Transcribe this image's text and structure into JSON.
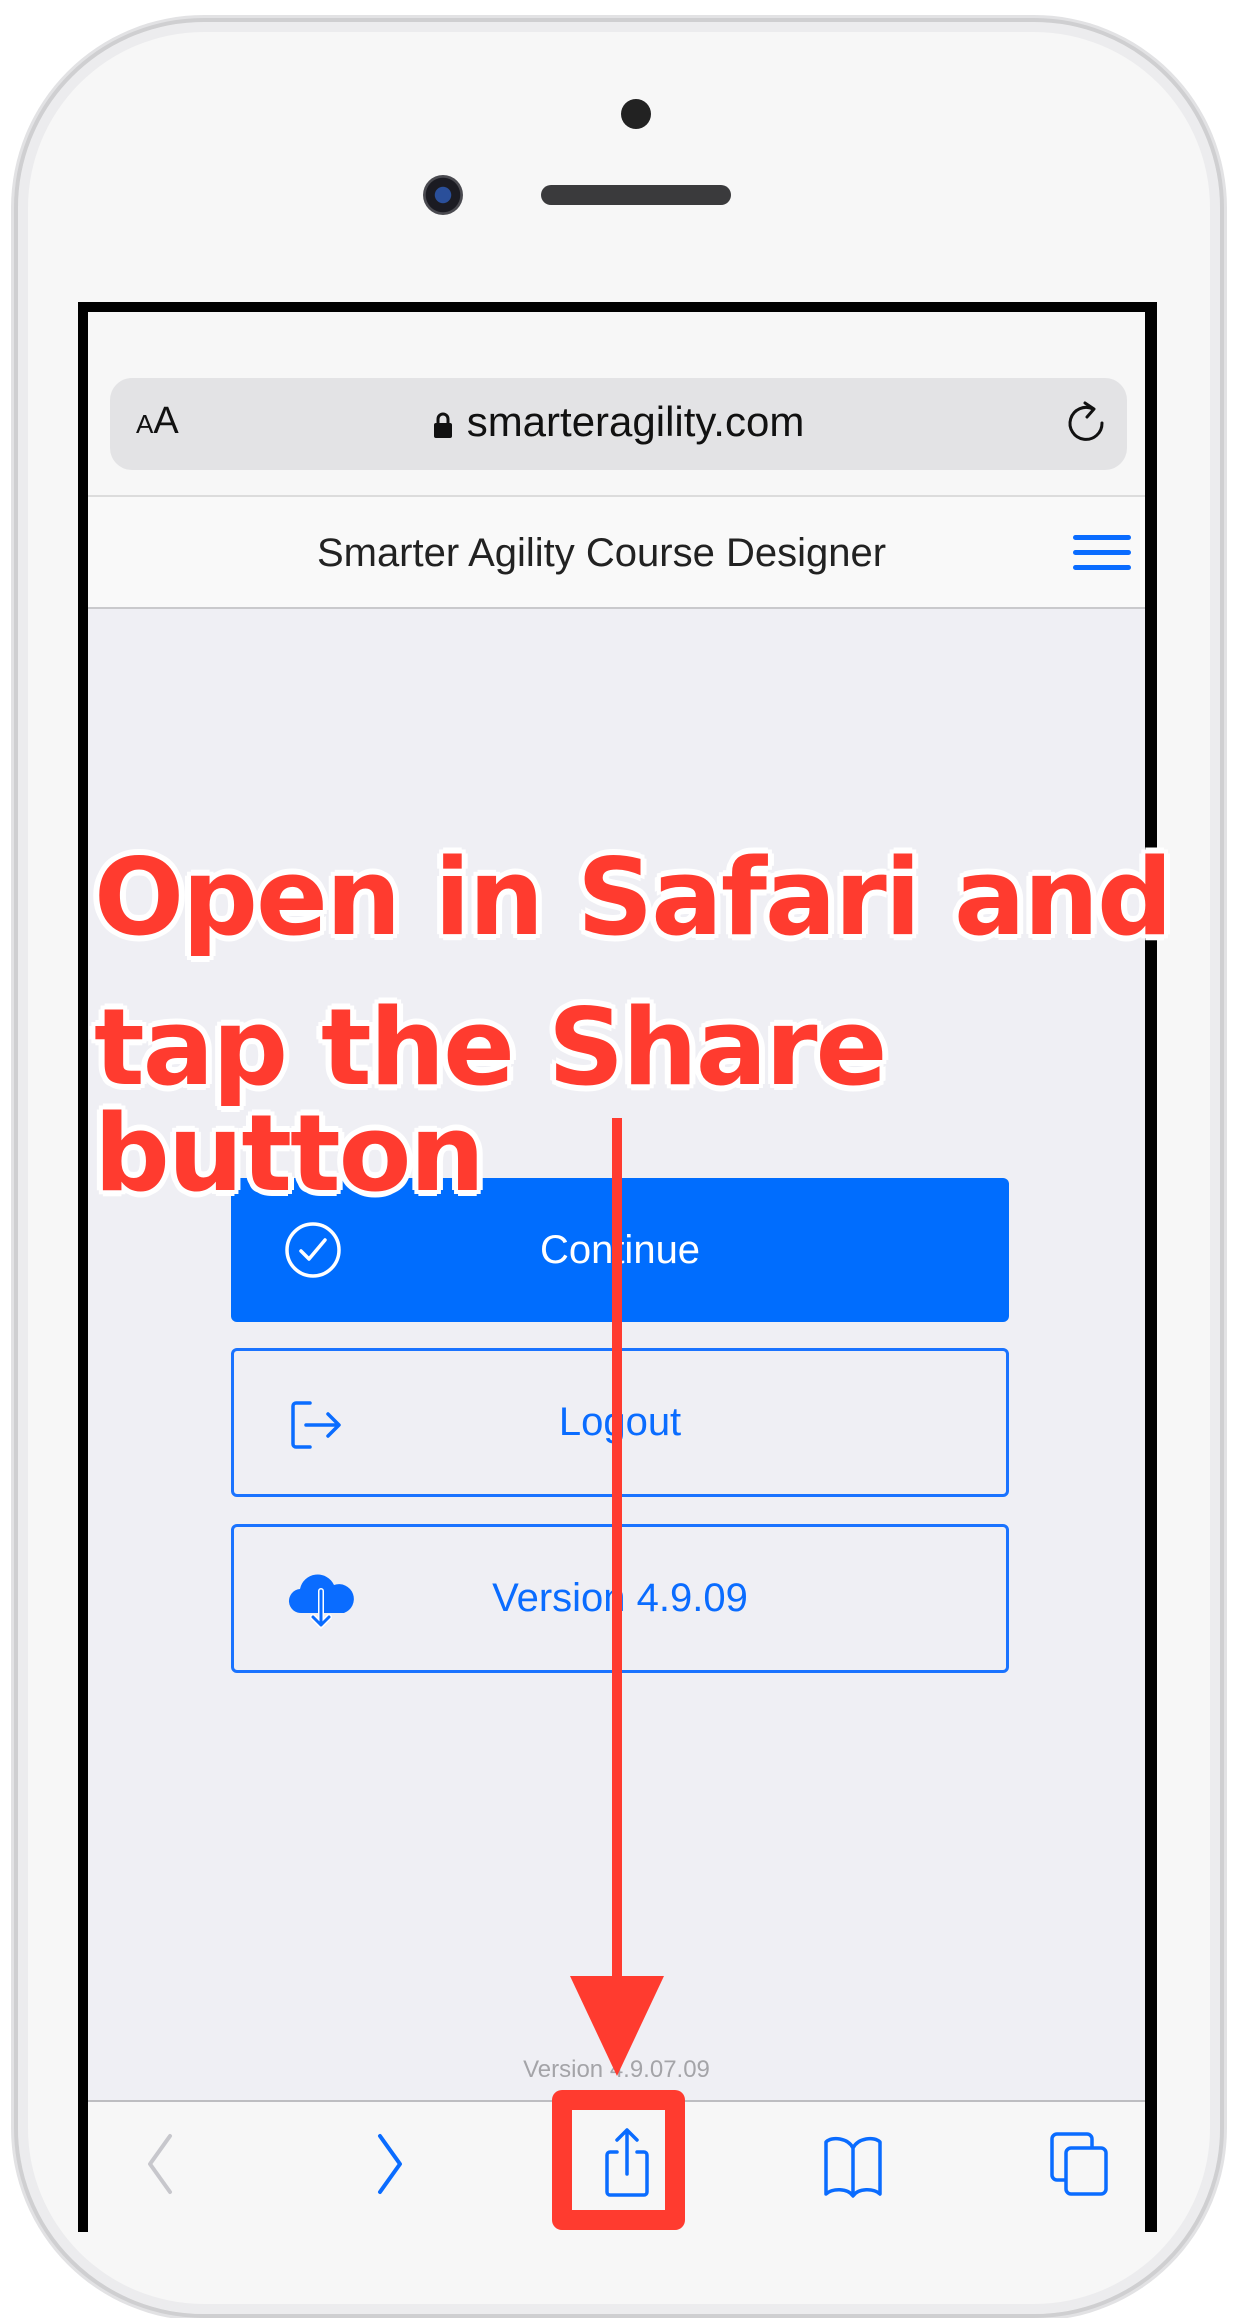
{
  "browser": {
    "text_size_label_small": "A",
    "text_size_label_large": "A",
    "url": "smarteragility.com"
  },
  "app": {
    "title": "Smarter Agility Course Designer"
  },
  "buttons": {
    "continue_label": "Continue",
    "logout_label": "Logout",
    "version_label": "Version 4.9.09"
  },
  "footer": {
    "version_text": "Version 4.9.07.09"
  },
  "toolbar": {
    "back": "back-icon",
    "forward": "forward-icon",
    "share": "share-icon",
    "bookmarks": "bookmarks-icon",
    "tabs": "tabs-icon"
  },
  "annotation": {
    "line1": "Open in Safari and",
    "line2": "tap the Share button"
  },
  "colors": {
    "accent": "#006dfe",
    "annotation": "#ff3b2f",
    "disabled": "#c7c7cc"
  }
}
